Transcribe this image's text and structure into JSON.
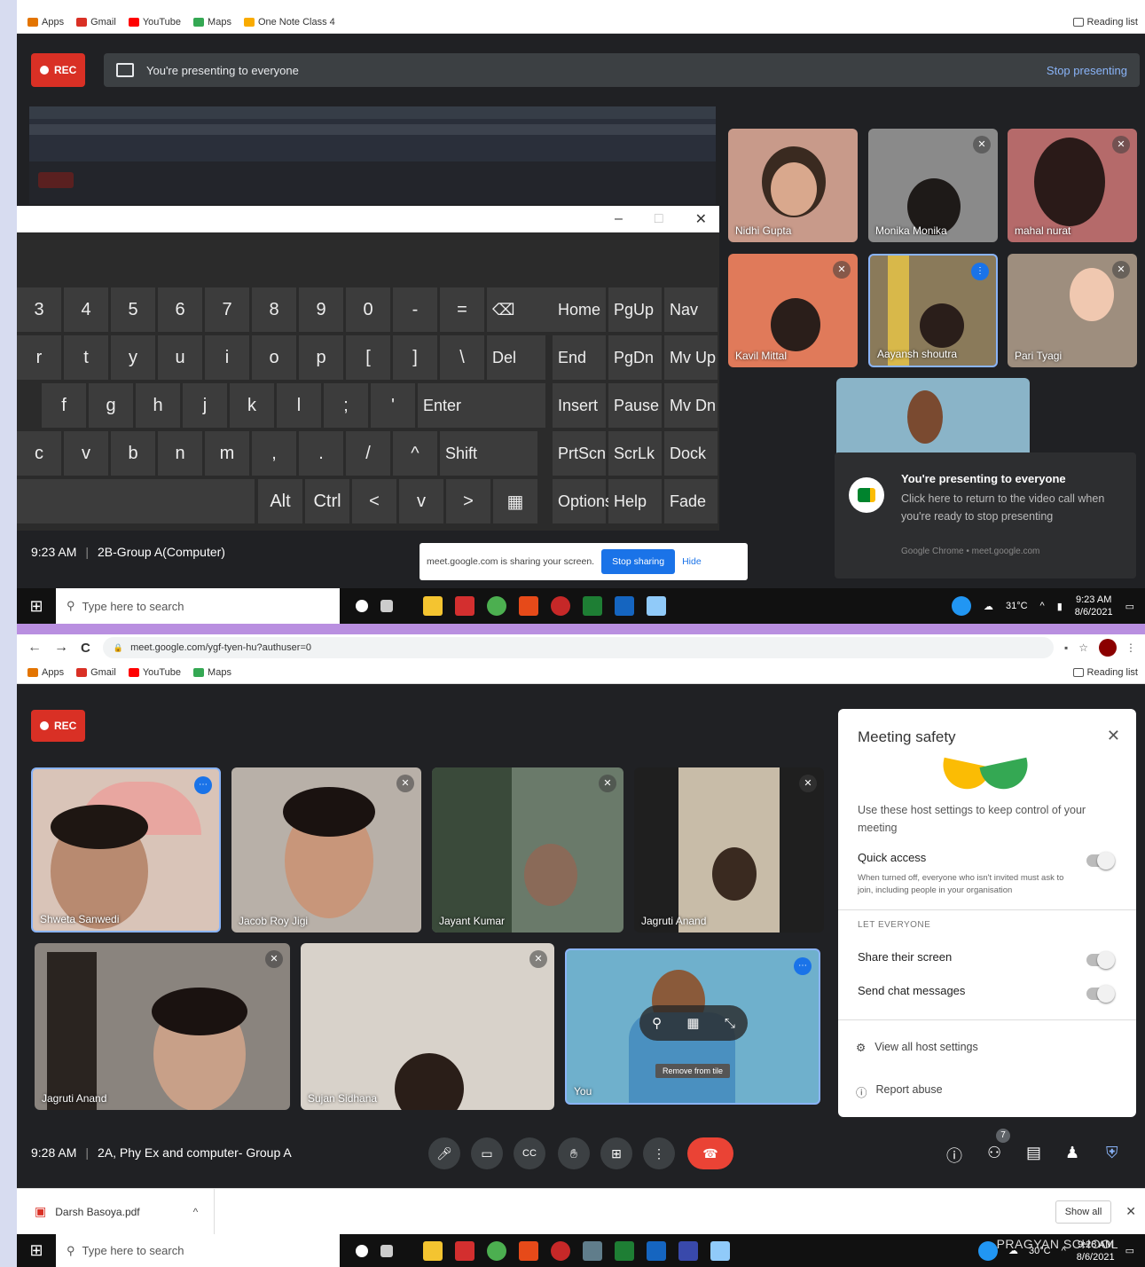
{
  "top": {
    "bookmarks": [
      {
        "label": "Apps",
        "color": "#e37400"
      },
      {
        "label": "Gmail",
        "color": "#d93025"
      },
      {
        "label": "YouTube",
        "color": "#ff0000"
      },
      {
        "label": "Maps",
        "color": "#34a853"
      },
      {
        "label": "One Note Class 4",
        "color": "#f9ab00"
      }
    ],
    "reading_list": "Reading list",
    "rec": "REC",
    "presenting_banner": "You're presenting to everyone",
    "stop_presenting": "Stop presenting",
    "keyboard": {
      "row1": [
        "3",
        "4",
        "5",
        "6",
        "7",
        "8",
        "9",
        "0",
        "-",
        "=",
        "⌫"
      ],
      "row2": [
        "r",
        "t",
        "y",
        "u",
        "i",
        "o",
        "p",
        "[",
        "]",
        "\\",
        "Del"
      ],
      "row3": [
        "f",
        "g",
        "h",
        "j",
        "k",
        "l",
        ";",
        "'",
        "Enter"
      ],
      "row4": [
        "c",
        "v",
        "b",
        "n",
        "m",
        ",",
        ".",
        "/",
        "^",
        "Shift"
      ],
      "row5": [
        "Alt",
        "Ctrl",
        "<",
        "v",
        ">",
        "▦"
      ],
      "nav": [
        "Home",
        "PgUp",
        "Nav",
        "End",
        "PgDn",
        "Mv Up",
        "Insert",
        "Pause",
        "Mv Dn",
        "PrtScn",
        "ScrLk",
        "Dock",
        "Options",
        "Help",
        "Fade"
      ]
    },
    "participants": [
      "Nidhi Gupta",
      "Monika Monika",
      "mahal nurat",
      "Kavil Mittal",
      "Aayansh shoutra",
      "Pari Tyagi"
    ],
    "toast": {
      "title": "You're presenting to everyone",
      "body": "Click here to return to the video call when you're ready to stop presenting",
      "source": "Google Chrome • meet.google.com"
    },
    "meeting_time": "9:23 AM",
    "meeting_title": "2B-Group A(Computer)",
    "share_bar": {
      "text": "meet.google.com is sharing your screen.",
      "stop": "Stop sharing",
      "hide": "Hide"
    },
    "taskbar": {
      "search": "Type here to search",
      "temp": "31°C",
      "time": "9:23 AM",
      "date": "8/6/2021"
    }
  },
  "bottom": {
    "url": "meet.google.com/ygf-tyen-hu?authuser=0",
    "bookmarks": [
      {
        "label": "Apps",
        "color": "#e37400"
      },
      {
        "label": "Gmail",
        "color": "#d93025"
      },
      {
        "label": "YouTube",
        "color": "#ff0000"
      },
      {
        "label": "Maps",
        "color": "#34a853"
      }
    ],
    "reading_list": "Reading list",
    "rec": "REC",
    "participants": [
      "Shweta Sanwedi",
      "Jacob Roy Jigi",
      "Jayant Kumar",
      "Jagruti Anand",
      "Jagruti Anand",
      "Sujan Sidhana",
      "You"
    ],
    "pin_label": "Remove from tile",
    "safety": {
      "title": "Meeting safety",
      "desc": "Use these host settings to keep control of your meeting",
      "quick_access": "Quick access",
      "quick_desc": "When turned off, everyone who isn't invited must ask to join, including people in your organisation",
      "let_everyone": "LET EVERYONE",
      "share_screen": "Share their screen",
      "send_chat": "Send chat messages",
      "view_all": "View all host settings",
      "report": "Report abuse"
    },
    "meeting_time": "9:28 AM",
    "meeting_title": "2A, Phy Ex and computer- Group A",
    "people_count": "7",
    "download": {
      "file": "Darsh Basoya.pdf",
      "show_all": "Show all"
    },
    "taskbar": {
      "search": "Type here to search",
      "temp": "30°C",
      "time": "9:28 AM",
      "date": "8/6/2021"
    },
    "watermark": "PRAGYAN SCHOOL"
  }
}
